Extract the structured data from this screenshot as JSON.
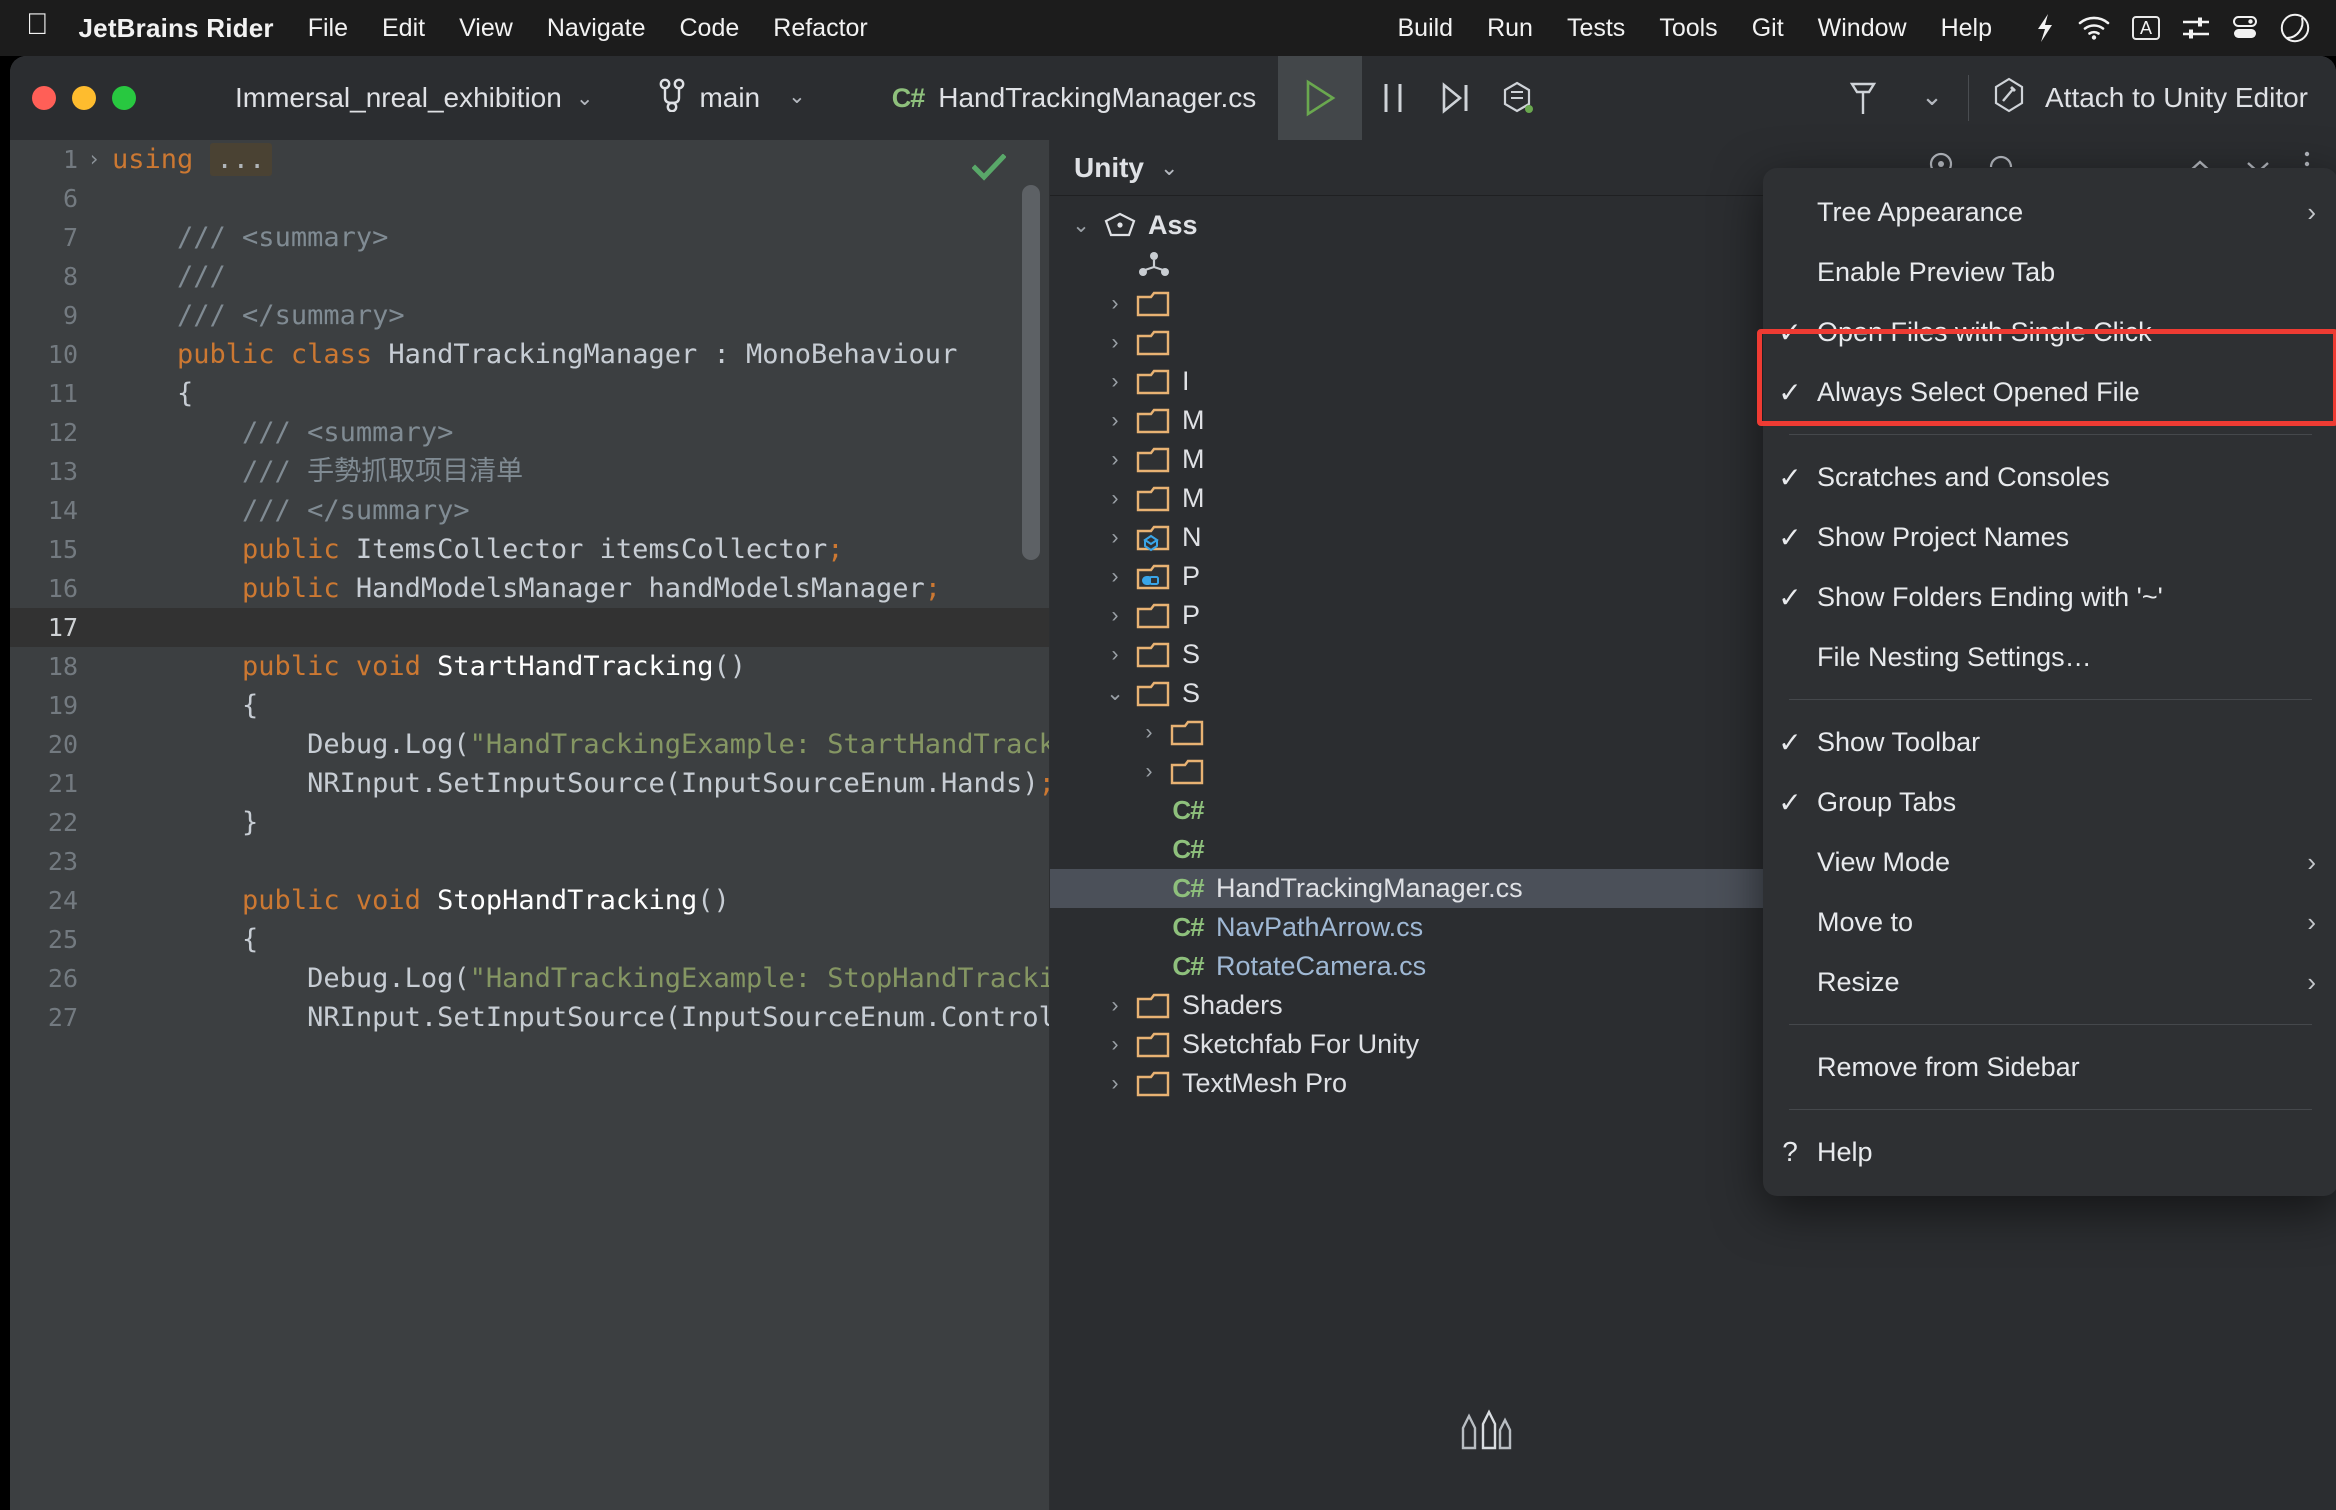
{
  "macos_menubar": {
    "apple_icon": "apple-logo-icon",
    "app_name": "JetBrains Rider",
    "left_items": [
      "File",
      "Edit",
      "View",
      "Navigate",
      "Code",
      "Refactor"
    ],
    "right_items": [
      "Build",
      "Run",
      "Tests",
      "Tools",
      "Git",
      "Window",
      "Help"
    ],
    "status_icons": [
      "battery-icon",
      "wifi-icon",
      "input-source-A-icon",
      "control-center-icon",
      "toggles-icon",
      "siri-icon"
    ],
    "input_source_label": "A"
  },
  "titlebar": {
    "traffic_lights": [
      "close-button",
      "minimize-button",
      "maximize-button"
    ],
    "project_name": "Immersal_nreal_exhibition",
    "project_chevron": "⌄",
    "branch_icon": "branch-icon",
    "branch_name": "main",
    "branch_chevron": "⌄",
    "file_badge": "C#",
    "file_name": "HandTrackingManager.cs",
    "run_icon": "run-icon",
    "pause_icon": "pause-icon",
    "step_over_icon": "step-over-icon",
    "coverage_icon": "run-with-coverage-icon",
    "build_icon": "build-hammer-icon",
    "more_chevron": "⌄",
    "attach_icon": "attach-debugger-icon",
    "attach_label": "Attach to Unity Editor"
  },
  "editor": {
    "inspection_status": "check-ok-icon",
    "current_line": 17,
    "lines": [
      {
        "num": "1",
        "fold": "›",
        "segments": [
          {
            "t": "using",
            "c": "kw"
          },
          {
            "t": " ",
            "c": "id"
          },
          {
            "t": "...",
            "c": "folded"
          }
        ]
      },
      {
        "num": "6",
        "fold": "",
        "segments": []
      },
      {
        "num": "7",
        "fold": "",
        "segments": [
          {
            "t": "/// <summary>",
            "c": "cm"
          }
        ],
        "indent": 1
      },
      {
        "num": "8",
        "fold": "",
        "segments": [
          {
            "t": "///",
            "c": "cm"
          }
        ],
        "indent": 1
      },
      {
        "num": "9",
        "fold": "",
        "segments": [
          {
            "t": "/// </summary>",
            "c": "cm"
          }
        ],
        "indent": 1
      },
      {
        "num": "10",
        "fold": "",
        "segments": [
          {
            "t": "public class ",
            "c": "kw"
          },
          {
            "t": "HandTrackingManager",
            "c": "id"
          },
          {
            "t": " : ",
            "c": "pn"
          },
          {
            "t": "MonoBehaviour",
            "c": "id"
          }
        ],
        "indent": 1
      },
      {
        "num": "11",
        "fold": "",
        "segments": [
          {
            "t": "{",
            "c": "pn"
          }
        ],
        "indent": 1
      },
      {
        "num": "12",
        "fold": "",
        "segments": [
          {
            "t": "/// <summary>",
            "c": "cm"
          }
        ],
        "indent": 2
      },
      {
        "num": "13",
        "fold": "",
        "segments": [
          {
            "t": "/// 手勢抓取项目清单",
            "c": "cm"
          }
        ],
        "indent": 2
      },
      {
        "num": "14",
        "fold": "",
        "segments": [
          {
            "t": "/// </summary>",
            "c": "cm"
          }
        ],
        "indent": 2
      },
      {
        "num": "15",
        "fold": "",
        "segments": [
          {
            "t": "public ",
            "c": "kw"
          },
          {
            "t": "ItemsCollector itemsCollector",
            "c": "id"
          },
          {
            "t": ";",
            "c": "sm"
          }
        ],
        "indent": 2
      },
      {
        "num": "16",
        "fold": "",
        "segments": [
          {
            "t": "public ",
            "c": "kw"
          },
          {
            "t": "HandModelsManager handModelsManager",
            "c": "id"
          },
          {
            "t": ";",
            "c": "sm"
          }
        ],
        "indent": 2
      },
      {
        "num": "17",
        "fold": "",
        "segments": [],
        "current": true
      },
      {
        "num": "18",
        "fold": "",
        "segments": [
          {
            "t": "public void ",
            "c": "kw"
          },
          {
            "t": "StartHandTracking",
            "c": "fn"
          },
          {
            "t": "()",
            "c": "pn"
          }
        ],
        "indent": 2
      },
      {
        "num": "19",
        "fold": "",
        "segments": [
          {
            "t": "{",
            "c": "pn"
          }
        ],
        "indent": 2
      },
      {
        "num": "20",
        "fold": "",
        "segments": [
          {
            "t": "Debug.Log(",
            "c": "id"
          },
          {
            "t": "\"HandTrackingExample: StartHandTracking\"",
            "c": "str"
          },
          {
            "t": ");",
            "c": "sm"
          }
        ],
        "indent": 3
      },
      {
        "num": "21",
        "fold": "",
        "segments": [
          {
            "t": "NRInput.SetInputSource(InputSourceEnum.Hands)",
            "c": "id"
          },
          {
            "t": ";",
            "c": "sm"
          }
        ],
        "indent": 3
      },
      {
        "num": "22",
        "fold": "",
        "segments": [
          {
            "t": "}",
            "c": "pn"
          }
        ],
        "indent": 2
      },
      {
        "num": "23",
        "fold": "",
        "segments": []
      },
      {
        "num": "24",
        "fold": "",
        "segments": [
          {
            "t": "public void ",
            "c": "kw"
          },
          {
            "t": "StopHandTracking",
            "c": "fn"
          },
          {
            "t": "()",
            "c": "pn"
          }
        ],
        "indent": 2
      },
      {
        "num": "25",
        "fold": "",
        "segments": [
          {
            "t": "{",
            "c": "pn"
          }
        ],
        "indent": 2
      },
      {
        "num": "26",
        "fold": "",
        "segments": [
          {
            "t": "Debug.Log(",
            "c": "id"
          },
          {
            "t": "\"HandTrackingExample: StopHandTracking\"",
            "c": "str"
          },
          {
            "t": ");",
            "c": "sm"
          }
        ],
        "indent": 3
      },
      {
        "num": "27",
        "fold": "",
        "segments": [
          {
            "t": "NRInput.SetInputSource(InputSourceEnum.Controller)",
            "c": "id"
          },
          {
            "t": ";",
            "c": "sm"
          }
        ],
        "indent": 3
      }
    ]
  },
  "toolwindow": {
    "title": "Unity",
    "title_chevron": "⌄",
    "header_icons": [
      "locate-icon",
      "collapse-icon",
      "expand-all-icon",
      "collapse-all-icon",
      "more-options-icon"
    ],
    "tree": [
      {
        "arrow": "⌄",
        "icon": "unity-assets-icon",
        "label": "Ass",
        "indent": 0,
        "bold": true
      },
      {
        "arrow": "",
        "icon": "scene-icon",
        "label": "",
        "indent": 1
      },
      {
        "arrow": "›",
        "icon": "folder-icon",
        "label": "",
        "indent": 1
      },
      {
        "arrow": "›",
        "icon": "folder-icon",
        "label": "",
        "indent": 1
      },
      {
        "arrow": "›",
        "icon": "folder-icon",
        "label": "I",
        "indent": 1
      },
      {
        "arrow": "›",
        "icon": "folder-icon",
        "label": "M",
        "indent": 1
      },
      {
        "arrow": "›",
        "icon": "folder-icon",
        "label": "M",
        "indent": 1
      },
      {
        "arrow": "›",
        "icon": "folder-icon",
        "label": "M",
        "indent": 1
      },
      {
        "arrow": "›",
        "icon": "folder-model-icon",
        "label": "N",
        "indent": 1
      },
      {
        "arrow": "›",
        "icon": "folder-prefab-icon",
        "label": "P",
        "indent": 1
      },
      {
        "arrow": "›",
        "icon": "folder-icon",
        "label": "P",
        "indent": 1
      },
      {
        "arrow": "›",
        "icon": "folder-icon",
        "label": "S",
        "indent": 1
      },
      {
        "arrow": "⌄",
        "icon": "folder-icon",
        "label": "S",
        "indent": 1
      },
      {
        "arrow": "›",
        "icon": "folder-icon",
        "label": "",
        "indent": 2
      },
      {
        "arrow": "›",
        "icon": "folder-icon",
        "label": "",
        "indent": 2
      },
      {
        "arrow": "",
        "icon": "cs-file-icon",
        "label": "",
        "indent": 2
      },
      {
        "arrow": "",
        "icon": "cs-file-icon",
        "label": "",
        "indent": 2
      }
    ],
    "files": [
      {
        "badge": "C#",
        "label": "HandTrackingManager.cs",
        "selected": true
      },
      {
        "badge": "C#",
        "label": "NavPathArrow.cs",
        "selected": false
      },
      {
        "badge": "C#",
        "label": "RotateCamera.cs",
        "selected": false
      }
    ],
    "folders_bottom": [
      {
        "arrow": "›",
        "label": "Shaders"
      },
      {
        "arrow": "›",
        "label": "Sketchfab For Unity"
      },
      {
        "arrow": "›",
        "label": "TextMesh Pro"
      }
    ]
  },
  "context_menu": {
    "items": [
      {
        "check": "",
        "label": "Tree Appearance",
        "submenu": "›",
        "highlighted": false
      },
      {
        "check": "",
        "label": "Enable Preview Tab",
        "submenu": "",
        "highlighted": false
      },
      {
        "check": "✓",
        "label": "Open Files with Single Click",
        "submenu": "",
        "highlighted": true
      },
      {
        "check": "✓",
        "label": "Always Select Opened File",
        "submenu": "",
        "highlighted": true
      },
      {
        "separator": true
      },
      {
        "check": "✓",
        "label": "Scratches and Consoles",
        "submenu": "",
        "highlighted": false
      },
      {
        "check": "✓",
        "label": "Show Project Names",
        "submenu": "",
        "highlighted": false
      },
      {
        "check": "✓",
        "label": "Show Folders Ending with '~'",
        "submenu": "",
        "highlighted": false
      },
      {
        "check": "",
        "label": "File Nesting Settings…",
        "submenu": "",
        "highlighted": false
      },
      {
        "separator": true
      },
      {
        "check": "✓",
        "label": "Show Toolbar",
        "submenu": "",
        "highlighted": false
      },
      {
        "check": "✓",
        "label": "Group Tabs",
        "submenu": "",
        "highlighted": false
      },
      {
        "check": "",
        "label": "View Mode",
        "submenu": "›",
        "highlighted": false
      },
      {
        "check": "",
        "label": "Move to",
        "submenu": "›",
        "highlighted": false
      },
      {
        "check": "",
        "label": "Resize",
        "submenu": "›",
        "highlighted": false
      },
      {
        "separator": true
      },
      {
        "check": "",
        "label": "Remove from Sidebar",
        "submenu": "",
        "highlighted": false
      },
      {
        "separator": true
      },
      {
        "check": "?",
        "label": "Help",
        "submenu": "",
        "highlighted": false
      }
    ],
    "highlight_color": "#ee3b33"
  },
  "colors": {
    "editor_bg": "#3c3f41",
    "panel_bg": "#2b2d30",
    "menu_bg": "#2e3033",
    "accent_red": "#ee3b33",
    "keyword_orange": "#cc7832",
    "string_green": "#859663",
    "comment_gray": "#808b93",
    "selection_blue": "#4b5059",
    "cs_green": "#8ec07c",
    "folder_orange": "#e8b273"
  }
}
